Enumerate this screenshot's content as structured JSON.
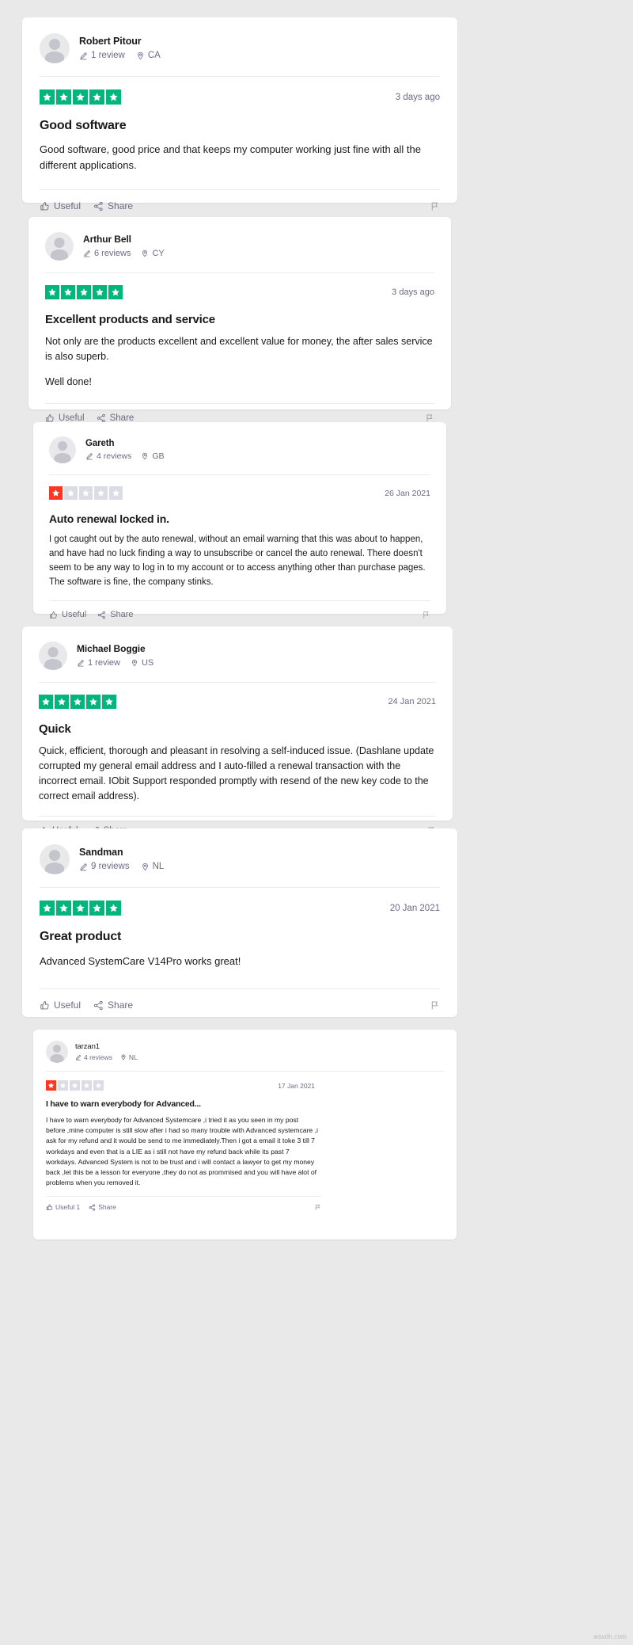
{
  "theme": {
    "page_bg": "#e9e9e9",
    "card_bg": "#ffffff",
    "star_green": "#00b67a",
    "star_red": "#ff3722",
    "star_empty": "#dcdce6",
    "text_primary": "#191919",
    "text_muted": "#6b6b82"
  },
  "labels": {
    "useful": "Useful",
    "share": "Share",
    "useful_with_count": "Useful 1",
    "review_singular": "1 review"
  },
  "watermark": "wsxdn.com",
  "reviews": [
    {
      "name": "Robert Pitour",
      "reviews_count": "1 review",
      "country": "CA",
      "rating": 5,
      "date": "3 days ago",
      "title": "Good software",
      "paragraphs": [
        "Good software, good price and that keeps my computer working just fine with all the different applications."
      ],
      "useful_label": "Useful",
      "share_label": "Share"
    },
    {
      "name": "Arthur Bell",
      "reviews_count": "6 reviews",
      "country": "CY",
      "rating": 5,
      "date": "3 days ago",
      "title": "Excellent products and service",
      "paragraphs": [
        "Not only are the products excellent and excellent value for money, the after sales service is also superb.",
        "Well done!"
      ],
      "useful_label": "Useful",
      "share_label": "Share"
    },
    {
      "name": "Gareth",
      "reviews_count": "4 reviews",
      "country": "GB",
      "rating": 1,
      "date": "26 Jan 2021",
      "title": "Auto renewal locked in.",
      "paragraphs": [
        "I got caught out by the auto renewal, without an email warning that this was about to happen, and have had no luck finding a way to unsubscribe or cancel the auto renewal. There doesn't seem to be any way to log in to my account or to access anything other than purchase pages. The software is fine, the company stinks."
      ],
      "useful_label": "Useful",
      "share_label": "Share"
    },
    {
      "name": "Michael Boggie",
      "reviews_count": "1 review",
      "country": "US",
      "rating": 5,
      "date": "24 Jan 2021",
      "title": "Quick",
      "paragraphs": [
        "Quick, efficient, thorough and pleasant in resolving a self-induced issue. (Dashlane update corrupted my general email address and I auto-filled a renewal transaction with the incorrect email. IObit Support responded promptly with resend of the new key code to the correct email address)."
      ],
      "useful_label": "Useful",
      "share_label": "Share"
    },
    {
      "name": "Sandman",
      "reviews_count": "9 reviews",
      "country": "NL",
      "rating": 5,
      "date": "20 Jan 2021",
      "title": "Great product",
      "paragraphs": [
        "Advanced SystemCare V14Pro works great!"
      ],
      "useful_label": "Useful",
      "share_label": "Share"
    },
    {
      "name": "tarzan1",
      "reviews_count": "4 reviews",
      "country": "NL",
      "rating": 1,
      "date": "17 Jan 2021",
      "title": "I have to warn everybody for Advanced...",
      "paragraphs": [
        "I have to warn everybody for Advanced Systemcare ,i tried it as you seen in my post before ,mine computer is still slow after i had so many trouble with Advanced systemcare ,i ask for my refund and it would be send to me immediately.Then i got a email it toke 3 till 7 workdays and even that is a LIE as i still not have my refund back while its past 7 workdays. Advanced System is not to be trust and i will contact a lawyer to get my money back ,let this be a lesson for everyone ,they do not as prommised and you will have alot of problems when you removed it."
      ],
      "useful_label": "Useful 1",
      "share_label": "Share"
    }
  ]
}
